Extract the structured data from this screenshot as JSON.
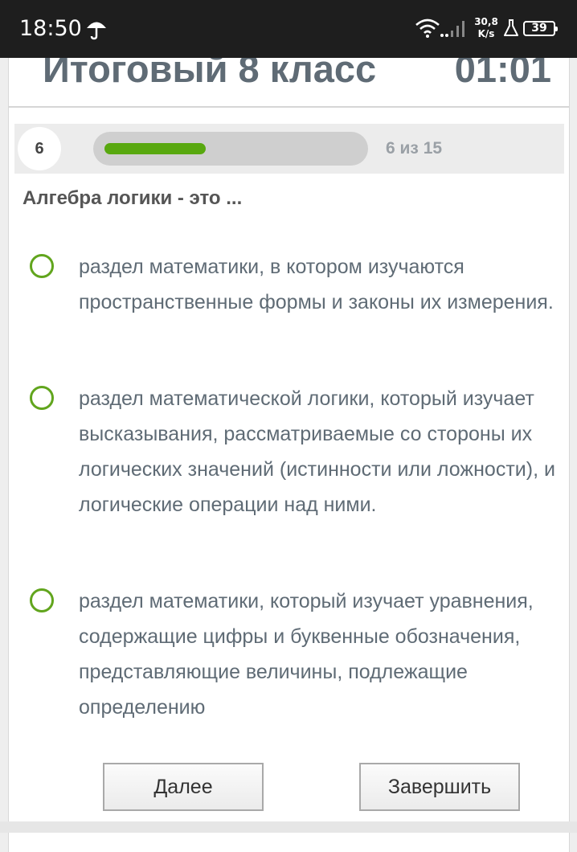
{
  "status_bar": {
    "time": "18:50",
    "speed_value": "30,8",
    "speed_unit": "K/s",
    "battery": "39",
    "icons": [
      "umbrella-icon",
      "wifi-icon",
      "signal-icon",
      "flask-icon",
      "battery-icon"
    ]
  },
  "header": {
    "title": "Итоговый 8 класс",
    "timer": "01:01"
  },
  "progress": {
    "current": "6",
    "label": "6 из 15",
    "fraction": 0.4,
    "color": "#58a80f"
  },
  "question": "Алгебра логики - это ...",
  "options": [
    "раздел математики, в котором изучаются пространственные формы и законы их измерения.",
    "раздел математической логики, который изучает высказывания, рассматриваемые со стороны их логических значений (истинности или ложности), и логические операции над ними.",
    "раздел математики, который изучает уравнения, содержащие цифры и буквенные обозначения, представляющие величины, подлежащие определению"
  ],
  "buttons": {
    "next": "Далее",
    "finish": "Завершить"
  },
  "colors": {
    "accent_green": "#61a51d",
    "text": "#5f6b75"
  }
}
